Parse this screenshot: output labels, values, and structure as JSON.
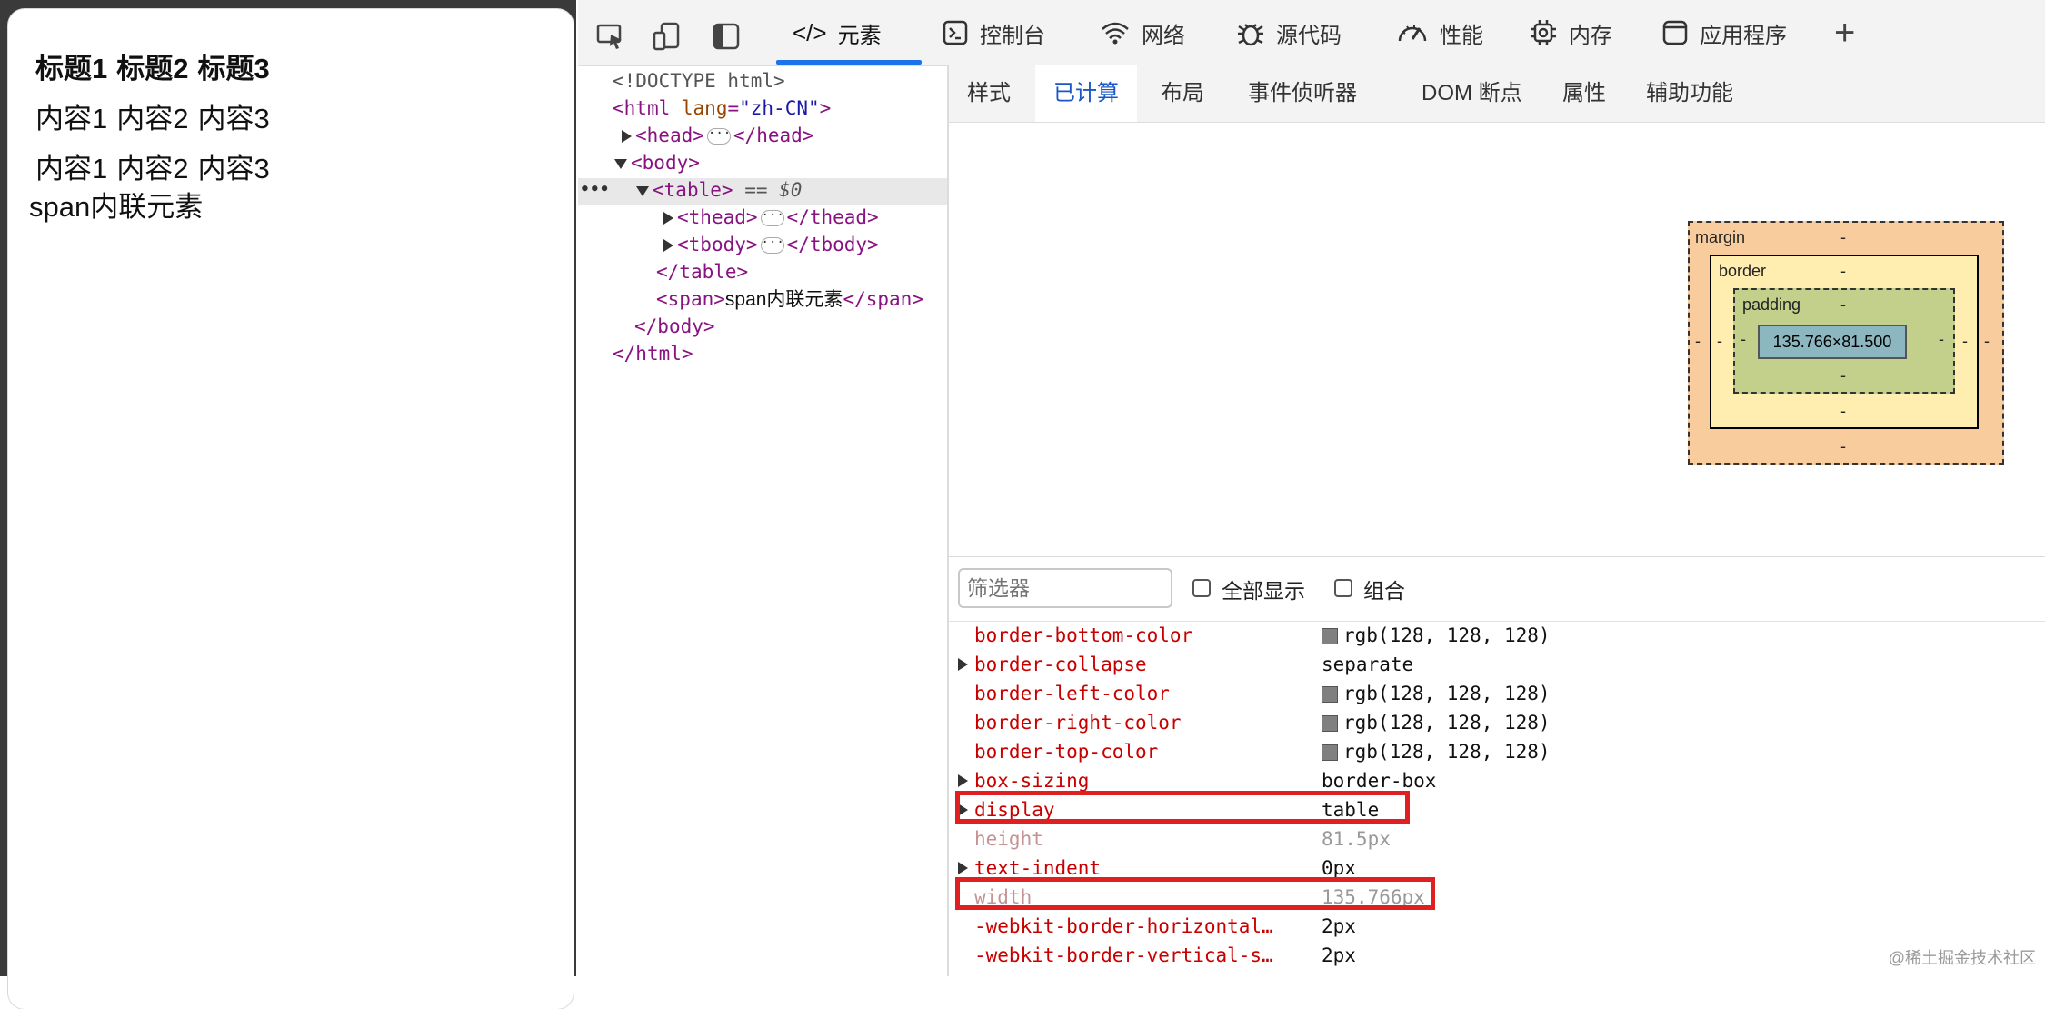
{
  "page": {
    "table": {
      "headers": [
        "标题1",
        "标题2",
        "标题3"
      ],
      "rows": [
        [
          "内容1",
          "内容2",
          "内容3"
        ],
        [
          "内容1",
          "内容2",
          "内容3"
        ]
      ]
    },
    "span_text": "span内联元素"
  },
  "devtools": {
    "tabs": [
      {
        "label": "元素",
        "icon": "code-icon",
        "active": true
      },
      {
        "label": "控制台",
        "icon": "console-icon"
      },
      {
        "label": "网络",
        "icon": "wifi-icon"
      },
      {
        "label": "源代码",
        "icon": "bug-icon"
      },
      {
        "label": "性能",
        "icon": "gauge-icon"
      },
      {
        "label": "内存",
        "icon": "chip-icon"
      },
      {
        "label": "应用程序",
        "icon": "window-icon"
      }
    ],
    "add_tab": "+",
    "dom": {
      "doctype": "<!DOCTYPE html>",
      "html_open_tag": "html",
      "html_attr_name": "lang",
      "html_attr_value": "\"zh-CN\"",
      "head": "head",
      "head_close": "/head",
      "body": "body",
      "table": "table",
      "selected_marker": "== $0",
      "thead": "thead",
      "thead_close": "/thead",
      "tbody": "tbody",
      "tbody_close": "/tbody",
      "table_close": "/table",
      "span": "span",
      "span_text": "span内联元素",
      "span_close": "/span",
      "body_close": "/body",
      "html_close": "/html",
      "row_menu": "•••"
    },
    "subtabs": [
      "样式",
      "已计算",
      "布局",
      "事件侦听器",
      "DOM 断点",
      "属性",
      "辅助功能"
    ],
    "active_subtab": "已计算",
    "box_model": {
      "margin_label": "margin",
      "border_label": "border",
      "padding_label": "padding",
      "content": "135.766×81.500",
      "dash": "-"
    },
    "filter": {
      "placeholder": "筛选器",
      "show_all": "全部显示",
      "group": "组合"
    },
    "computed": [
      {
        "name": "border-bottom-color",
        "value": "rgb(128, 128, 128)",
        "swatch": true
      },
      {
        "name": "border-collapse",
        "value": "separate",
        "expandable": true
      },
      {
        "name": "border-left-color",
        "value": "rgb(128, 128, 128)",
        "swatch": true
      },
      {
        "name": "border-right-color",
        "value": "rgb(128, 128, 128)",
        "swatch": true
      },
      {
        "name": "border-top-color",
        "value": "rgb(128, 128, 128)",
        "swatch": true
      },
      {
        "name": "box-sizing",
        "value": "border-box",
        "expandable": true
      },
      {
        "name": "display",
        "value": "table",
        "expandable": true,
        "highlighted": true
      },
      {
        "name": "height",
        "value": "81.5px",
        "dim": true
      },
      {
        "name": "text-indent",
        "value": "0px",
        "expandable": true
      },
      {
        "name": "width",
        "value": "135.766px",
        "dim": true,
        "highlighted": true
      },
      {
        "name": "-webkit-border-horizontal…",
        "value": "2px"
      },
      {
        "name": "-webkit-border-vertical-s…",
        "value": "2px"
      }
    ],
    "watermark": "@稀土掘金技术社区"
  },
  "colors": {
    "accent": "#1a73e8",
    "highlight_box": "#e02020",
    "margin": "#f9cc9d",
    "border": "#ffeeaf",
    "padding": "#c3d08b",
    "content": "#8cb6c0"
  }
}
